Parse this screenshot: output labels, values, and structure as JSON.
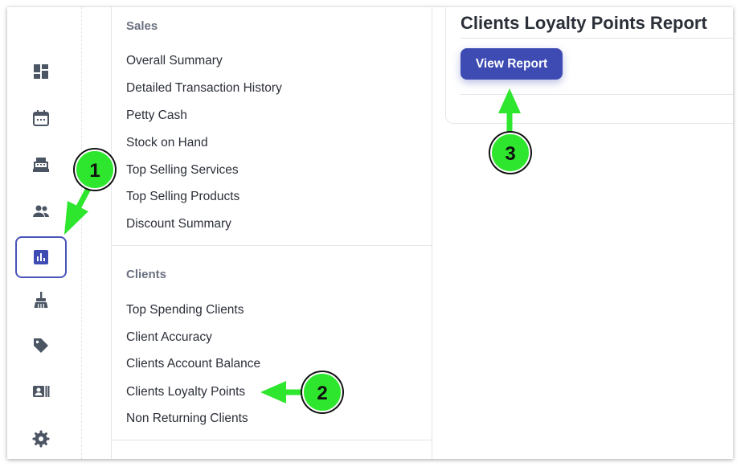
{
  "sidebar": {
    "icons": [
      {
        "name": "dashboard-icon",
        "active": false
      },
      {
        "name": "calendar-icon",
        "active": false
      },
      {
        "name": "cash-register-icon",
        "active": false
      },
      {
        "name": "clients-icon",
        "active": false
      },
      {
        "name": "reports-icon",
        "active": true
      },
      {
        "name": "cleaning-icon",
        "active": false
      },
      {
        "name": "tag-icon",
        "active": false
      },
      {
        "name": "staff-card-icon",
        "active": false
      },
      {
        "name": "settings-icon",
        "active": false
      }
    ]
  },
  "menu": {
    "sales": {
      "title": "Sales",
      "items": [
        "Overall Summary",
        "Detailed Transaction History",
        "Petty Cash",
        "Stock on Hand",
        "Top Selling Services",
        "Top Selling Products",
        "Discount Summary"
      ]
    },
    "clients": {
      "title": "Clients",
      "items": [
        "Top Spending Clients",
        "Client Accuracy",
        "Clients Account Balance",
        "Clients Loyalty Points",
        "Non Returning Clients"
      ]
    }
  },
  "report": {
    "title": "Clients Loyalty Points Report",
    "view_button": "View Report"
  },
  "annotations": {
    "steps": [
      "1",
      "2",
      "3"
    ],
    "color": "#2ee62e"
  },
  "colors": {
    "accent": "#3d4bb3",
    "icon": "#4b5563"
  }
}
